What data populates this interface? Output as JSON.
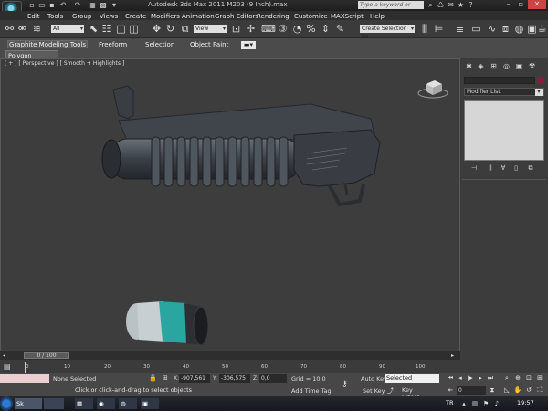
{
  "title_bar": {
    "title": "Autodesk 3ds Max 2011      M203 (9 Inch).max",
    "search_placeholder": "Type a keyword or phrase"
  },
  "menu": [
    "Edit",
    "Tools",
    "Group",
    "Views",
    "Create",
    "Modifiers",
    "Animation",
    "Graph Editors",
    "Rendering",
    "Customize",
    "MAXScript",
    "Help"
  ],
  "toolbar": {
    "selection_filter": "All",
    "reference_coord": "View",
    "named_selection": "Create Selection Se"
  },
  "ribbon": {
    "tabs": [
      "Graphite Modeling Tools",
      "Freeform",
      "Selection",
      "Object Paint"
    ],
    "panel": "Polygon Modeling"
  },
  "viewport": {
    "label": "[ + ] [ Perspective ] [ Smooth + Highlights ]"
  },
  "command_panel": {
    "modifier_list": "Modifier List"
  },
  "timeline": {
    "slider": "0 / 100",
    "ticks": [
      "0",
      "10",
      "20",
      "30",
      "40",
      "50",
      "60",
      "70",
      "80",
      "90",
      "100"
    ]
  },
  "status": {
    "maxscript": "",
    "selection": "None Selected",
    "hint": "Click or click-and-drag to select objects",
    "x_label": "X:",
    "x_value": "-907,561",
    "y_label": "Y:",
    "y_value": "-306,575",
    "z_label": "Z:",
    "z_value": "0,0",
    "grid": "Grid = 10,0",
    "add_time_tag": "Add Time Tag",
    "auto_key": "Auto Key",
    "selected": "Selected",
    "set_key": "Set Key",
    "key_filters": "Key Filters...",
    "frame": "0"
  },
  "taskbar": {
    "item1": "Sk",
    "item2": "",
    "lang": "TR",
    "clock": "19:57"
  },
  "colors": {
    "grenade_band": "#2aa6a1",
    "launcher": "#3a3d42",
    "swatch": "#8a1a3a"
  }
}
